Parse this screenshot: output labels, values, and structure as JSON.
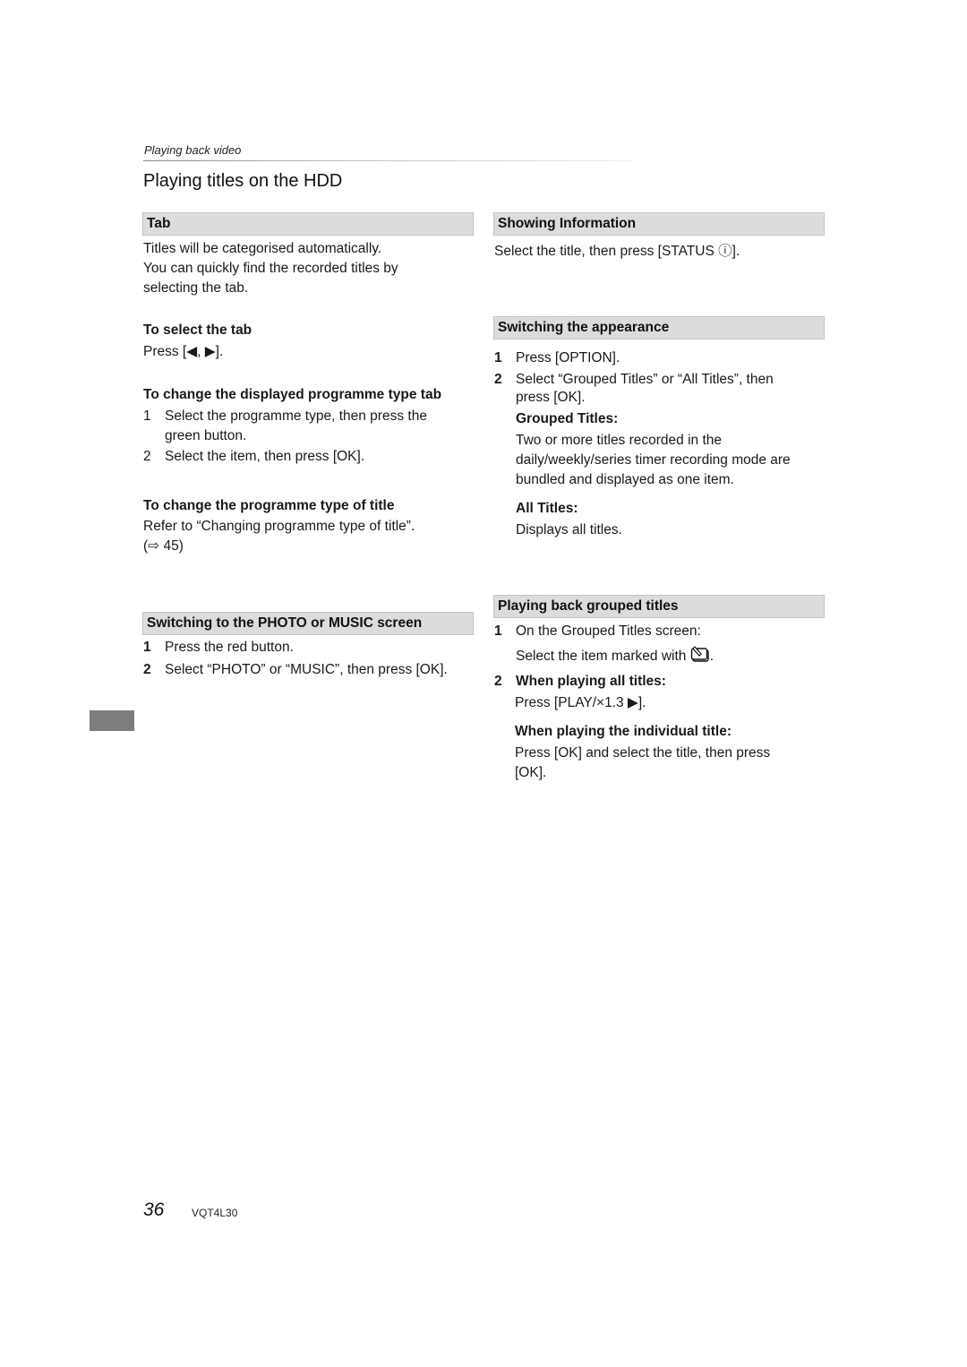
{
  "header": {
    "section": "Playing back video",
    "title": "Playing titles on the HDD"
  },
  "left": {
    "tab_section": {
      "heading": "Tab",
      "lines": [
        "Titles will be categorised automatically.",
        "You can quickly find the recorded titles by",
        "selecting the tab."
      ]
    },
    "select_tab": {
      "heading": "To select the tab",
      "text": "Press [◀, ▶]."
    },
    "change_tab": {
      "heading": "To change the displayed programme type tab",
      "steps": [
        {
          "num": "1",
          "lines": [
            "Select the programme type, then press the",
            "green button."
          ]
        },
        {
          "num": "2",
          "lines": [
            "Select the item, then press [OK]."
          ]
        }
      ]
    },
    "change_type": {
      "heading": "To change the programme type of title",
      "text": "Refer to “Changing programme type of title”.",
      "ref_arrow": "⇨",
      "ref_page": "45"
    },
    "photo_music": {
      "heading": "Switching to the PHOTO or MUSIC screen",
      "steps": [
        {
          "num": "1",
          "text": "Press the red button."
        },
        {
          "num": "2",
          "text": "Select “PHOTO” or “MUSIC”, then press [OK]."
        }
      ]
    }
  },
  "right": {
    "showing_info": {
      "heading": "Showing Information",
      "text_before": "Select the title, then press [STATUS ",
      "icon": "ⓘ",
      "text_after": "]."
    },
    "appearance": {
      "heading": "Switching the appearance",
      "step1": {
        "num": "1",
        "text": "Press [OPTION]."
      },
      "step2": {
        "num": "2",
        "lines": [
          "Select “Grouped Titles” or “All Titles”, then",
          "press [OK]."
        ]
      },
      "grouped": {
        "label": "Grouped Titles:",
        "lines": [
          "Two or more titles recorded in the",
          "daily/weekly/series timer recording mode are",
          "bundled and displayed as one item."
        ]
      },
      "all": {
        "label": "All Titles:",
        "text": "Displays all titles."
      }
    },
    "grouped_playback": {
      "heading": "Playing back grouped titles",
      "step1": {
        "num": "1",
        "line1": "On the Grouped Titles screen:",
        "line2": "Select the item marked with",
        "line2_end": "."
      },
      "step2": {
        "num": "2",
        "label": "When playing all titles:",
        "text": "Press [PLAY/×1.3 ▶]."
      },
      "individual": {
        "label": "When playing the individual title:",
        "lines": [
          "Press [OK] and select the title, then press",
          "[OK]."
        ]
      }
    }
  },
  "footer": {
    "page_number": "36",
    "code": "VQT4L30"
  }
}
